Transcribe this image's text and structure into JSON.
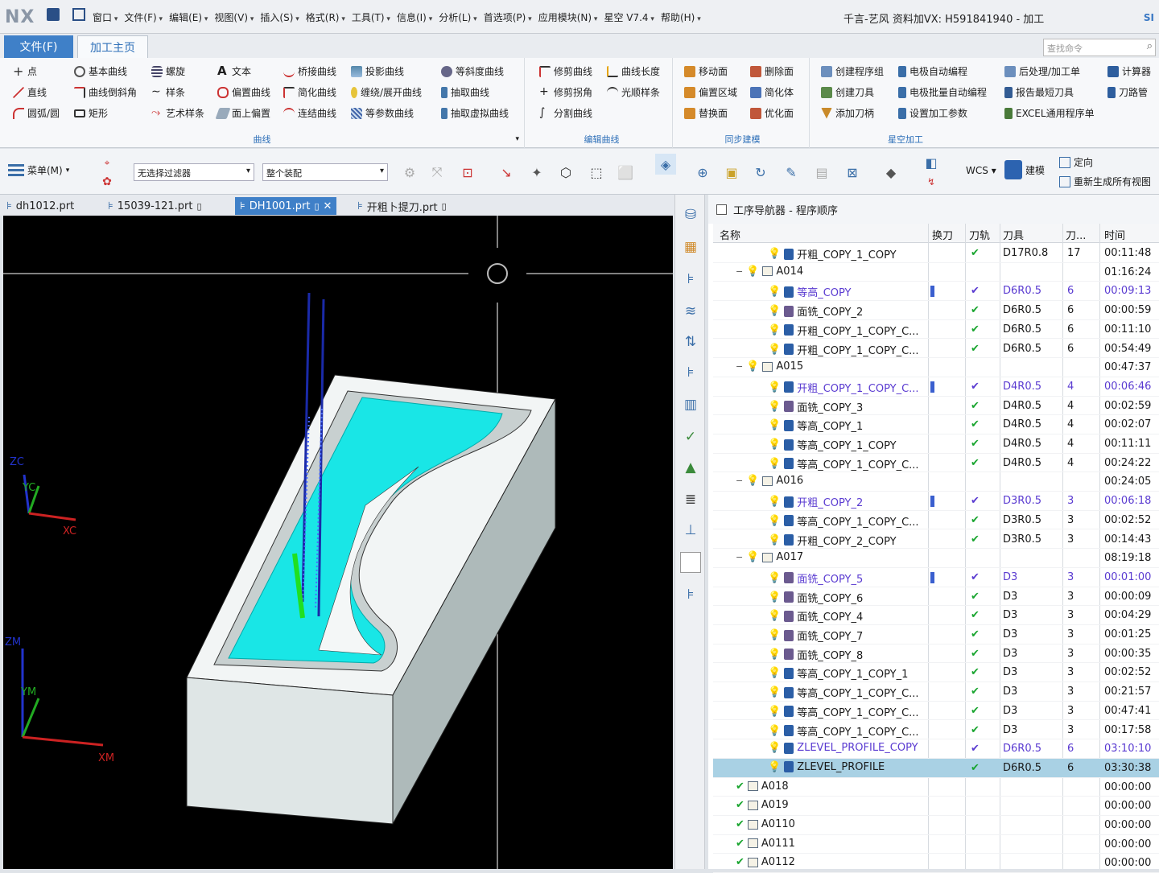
{
  "app": {
    "logo": "NX",
    "window_title": "千言-艺风 资料加VX: H591841940 - 加工",
    "right_tag": "SI",
    "menu": [
      "窗口",
      "文件(F)",
      "编辑(E)",
      "视图(V)",
      "插入(S)",
      "格式(R)",
      "工具(T)",
      "信息(I)",
      "分析(L)",
      "首选项(P)",
      "应用模块(N)",
      "星空 V7.4",
      "帮助(H)"
    ]
  },
  "ribbon": {
    "file_tab": "文件(F)",
    "main_tab": "加工主页",
    "search_placeholder": "查找命令",
    "groups": {
      "curve_label": "曲线",
      "edit_curve_label": "编辑曲线",
      "sync_label": "同步建模",
      "xingkong_label": "星空加工"
    },
    "col1": [
      "点",
      "直线",
      "圆弧/圆"
    ],
    "col2": [
      "基本曲线",
      "曲线倒斜角",
      "矩形"
    ],
    "col3": [
      "螺旋",
      "样条",
      "艺术样条"
    ],
    "col4": [
      "文本",
      "偏置曲线",
      "面上偏置"
    ],
    "col5": [
      "桥接曲线",
      "简化曲线",
      "连结曲线"
    ],
    "col6": [
      "投影曲线",
      "缠绕/展开曲线",
      "等参数曲线"
    ],
    "col7": [
      "等斜度曲线",
      "抽取曲线",
      "抽取虚拟曲线"
    ],
    "col8": [
      "修剪曲线",
      "修剪拐角",
      "分割曲线"
    ],
    "col9": [
      "曲线长度",
      "光顺样条"
    ],
    "col10": [
      "移动面",
      "偏置区域",
      "替换面"
    ],
    "col11": [
      "删除面",
      "简化体",
      "优化面"
    ],
    "col12": [
      "创建程序组",
      "创建刀具",
      "添加刀柄"
    ],
    "col13": [
      "电极自动编程",
      "电极批量自动编程",
      "设置加工参数"
    ],
    "col14": [
      "后处理/加工单",
      "报告最短刀具",
      "EXCEL通用程序单"
    ],
    "col15": [
      "计算器",
      "刀路管"
    ]
  },
  "toolbar": {
    "menu_label": "菜单(M)",
    "filter": "无选择过滤器",
    "assembly": "整个装配",
    "wcs": "WCS",
    "model": "建模",
    "orient": "定向",
    "regen": "重新生成所有视图"
  },
  "doc_tabs": [
    {
      "name": "dh1012.prt"
    },
    {
      "name": "15039-121.prt"
    },
    {
      "name": "DH1001.prt"
    },
    {
      "name": "开粗卜提刀.prt"
    }
  ],
  "viewport": {
    "axis_zc": "ZC",
    "axis_yc": "YC",
    "axis_xc": "XC",
    "axis_zm": "ZM",
    "axis_ym": "YM",
    "axis_xm": "XM"
  },
  "navigator": {
    "title": "工序导航器 - 程序顺序",
    "columns": [
      "名称",
      "换刀",
      "刀轨",
      "刀具",
      "刀...",
      "时间"
    ],
    "rows": [
      {
        "indent": 3,
        "kind": "op",
        "name": "开粗_COPY_1_COPY",
        "chg": "",
        "ok": "✔",
        "tool": "D17R0.8",
        "n": "17",
        "time": "00:11:48",
        "purple": false
      },
      {
        "indent": 1,
        "kind": "grp",
        "name": "A014",
        "chg": "",
        "ok": "",
        "tool": "",
        "n": "",
        "time": "01:16:24",
        "purple": false
      },
      {
        "indent": 3,
        "kind": "op",
        "name": "等高_COPY",
        "chg": "bar",
        "ok": "✔",
        "tool": "D6R0.5",
        "n": "6",
        "time": "00:09:13",
        "purple": true
      },
      {
        "indent": 3,
        "kind": "face",
        "name": "面铣_COPY_2",
        "chg": "",
        "ok": "✔",
        "tool": "D6R0.5",
        "n": "6",
        "time": "00:00:59",
        "purple": false
      },
      {
        "indent": 3,
        "kind": "op",
        "name": "开粗_COPY_1_COPY_C...",
        "chg": "",
        "ok": "✔",
        "tool": "D6R0.5",
        "n": "6",
        "time": "00:11:10",
        "purple": false
      },
      {
        "indent": 3,
        "kind": "op",
        "name": "开粗_COPY_1_COPY_C...",
        "chg": "",
        "ok": "✔",
        "tool": "D6R0.5",
        "n": "6",
        "time": "00:54:49",
        "purple": false
      },
      {
        "indent": 1,
        "kind": "grp",
        "name": "A015",
        "chg": "",
        "ok": "",
        "tool": "",
        "n": "",
        "time": "00:47:37",
        "purple": false
      },
      {
        "indent": 3,
        "kind": "op",
        "name": "开粗_COPY_1_COPY_C...",
        "chg": "bar",
        "ok": "✔",
        "tool": "D4R0.5",
        "n": "4",
        "time": "00:06:46",
        "purple": true
      },
      {
        "indent": 3,
        "kind": "face",
        "name": "面铣_COPY_3",
        "chg": "",
        "ok": "✔",
        "tool": "D4R0.5",
        "n": "4",
        "time": "00:02:59",
        "purple": false
      },
      {
        "indent": 3,
        "kind": "op",
        "name": "等高_COPY_1",
        "chg": "",
        "ok": "✔",
        "tool": "D4R0.5",
        "n": "4",
        "time": "00:02:07",
        "purple": false
      },
      {
        "indent": 3,
        "kind": "op",
        "name": "等高_COPY_1_COPY",
        "chg": "",
        "ok": "✔",
        "tool": "D4R0.5",
        "n": "4",
        "time": "00:11:11",
        "purple": false
      },
      {
        "indent": 3,
        "kind": "op",
        "name": "等高_COPY_1_COPY_C...",
        "chg": "",
        "ok": "✔",
        "tool": "D4R0.5",
        "n": "4",
        "time": "00:24:22",
        "purple": false
      },
      {
        "indent": 1,
        "kind": "grp",
        "name": "A016",
        "chg": "",
        "ok": "",
        "tool": "",
        "n": "",
        "time": "00:24:05",
        "purple": false
      },
      {
        "indent": 3,
        "kind": "op",
        "name": "开粗_COPY_2",
        "chg": "bar",
        "ok": "✔",
        "tool": "D3R0.5",
        "n": "3",
        "time": "00:06:18",
        "purple": true
      },
      {
        "indent": 3,
        "kind": "op",
        "name": "等高_COPY_1_COPY_C...",
        "chg": "",
        "ok": "✔",
        "tool": "D3R0.5",
        "n": "3",
        "time": "00:02:52",
        "purple": false
      },
      {
        "indent": 3,
        "kind": "op",
        "name": "开粗_COPY_2_COPY",
        "chg": "",
        "ok": "✔",
        "tool": "D3R0.5",
        "n": "3",
        "time": "00:14:43",
        "purple": false
      },
      {
        "indent": 1,
        "kind": "grp",
        "name": "A017",
        "chg": "",
        "ok": "",
        "tool": "",
        "n": "",
        "time": "08:19:18",
        "purple": false
      },
      {
        "indent": 3,
        "kind": "face",
        "name": "面铣_COPY_5",
        "chg": "bar",
        "ok": "✔",
        "tool": "D3",
        "n": "3",
        "time": "00:01:00",
        "purple": true
      },
      {
        "indent": 3,
        "kind": "face",
        "name": "面铣_COPY_6",
        "chg": "",
        "ok": "✔",
        "tool": "D3",
        "n": "3",
        "time": "00:00:09",
        "purple": false
      },
      {
        "indent": 3,
        "kind": "face",
        "name": "面铣_COPY_4",
        "chg": "",
        "ok": "✔",
        "tool": "D3",
        "n": "3",
        "time": "00:04:29",
        "purple": false
      },
      {
        "indent": 3,
        "kind": "face",
        "name": "面铣_COPY_7",
        "chg": "",
        "ok": "✔",
        "tool": "D3",
        "n": "3",
        "time": "00:01:25",
        "purple": false
      },
      {
        "indent": 3,
        "kind": "face",
        "name": "面铣_COPY_8",
        "chg": "",
        "ok": "✔",
        "tool": "D3",
        "n": "3",
        "time": "00:00:35",
        "purple": false
      },
      {
        "indent": 3,
        "kind": "op",
        "name": "等高_COPY_1_COPY_1",
        "chg": "",
        "ok": "✔",
        "tool": "D3",
        "n": "3",
        "time": "00:02:52",
        "purple": false
      },
      {
        "indent": 3,
        "kind": "op",
        "name": "等高_COPY_1_COPY_C...",
        "chg": "",
        "ok": "✔",
        "tool": "D3",
        "n": "3",
        "time": "00:21:57",
        "purple": false
      },
      {
        "indent": 3,
        "kind": "op",
        "name": "等高_COPY_1_COPY_C...",
        "chg": "",
        "ok": "✔",
        "tool": "D3",
        "n": "3",
        "time": "00:47:41",
        "purple": false
      },
      {
        "indent": 3,
        "kind": "op",
        "name": "等高_COPY_1_COPY_C...",
        "chg": "",
        "ok": "✔",
        "tool": "D3",
        "n": "3",
        "time": "00:17:58",
        "purple": false
      },
      {
        "indent": 3,
        "kind": "op",
        "name": "ZLEVEL_PROFILE_COPY",
        "chg": "",
        "ok": "✔",
        "tool": "D6R0.5",
        "n": "6",
        "time": "03:10:10",
        "purple": true
      },
      {
        "indent": 3,
        "kind": "op",
        "name": "ZLEVEL_PROFILE",
        "chg": "",
        "ok": "✔",
        "tool": "D6R0.5",
        "n": "6",
        "time": "03:30:38",
        "purple": false,
        "selected": true
      },
      {
        "indent": 1,
        "kind": "grpok",
        "name": "A018",
        "chg": "",
        "ok": "",
        "tool": "",
        "n": "",
        "time": "00:00:00",
        "purple": false
      },
      {
        "indent": 1,
        "kind": "grpok",
        "name": "A019",
        "chg": "",
        "ok": "",
        "tool": "",
        "n": "",
        "time": "00:00:00",
        "purple": false
      },
      {
        "indent": 1,
        "kind": "grpok",
        "name": "A0110",
        "chg": "",
        "ok": "",
        "tool": "",
        "n": "",
        "time": "00:00:00",
        "purple": false
      },
      {
        "indent": 1,
        "kind": "grpok",
        "name": "A0111",
        "chg": "",
        "ok": "",
        "tool": "",
        "n": "",
        "time": "00:00:00",
        "purple": false
      },
      {
        "indent": 1,
        "kind": "grpok",
        "name": "A0112",
        "chg": "",
        "ok": "",
        "tool": "",
        "n": "",
        "time": "00:00:00",
        "purple": false
      }
    ]
  }
}
